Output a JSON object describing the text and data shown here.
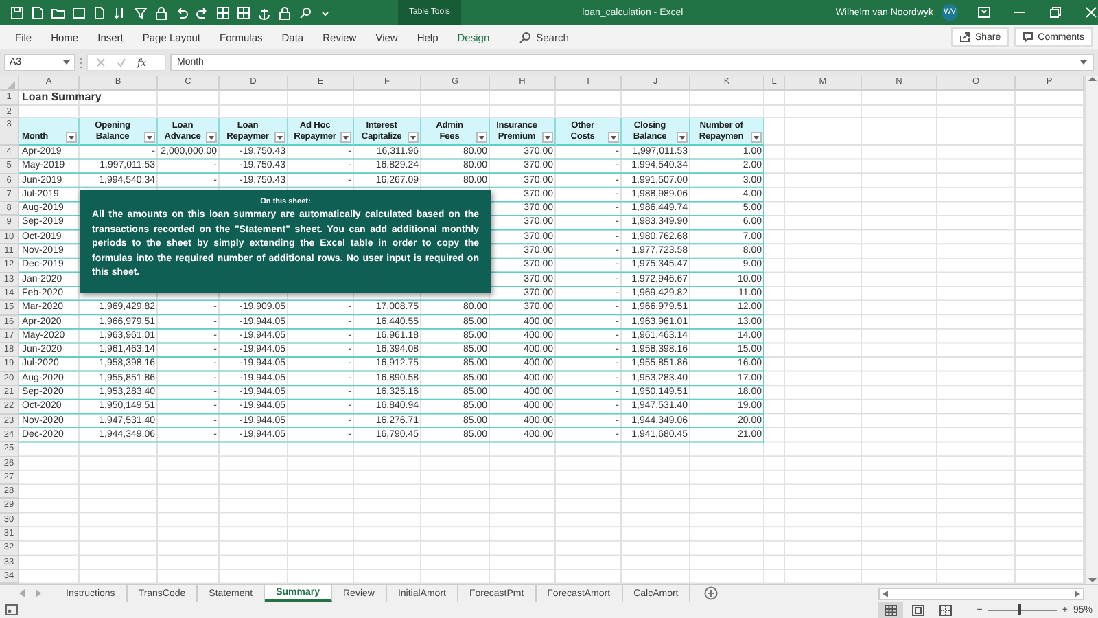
{
  "title_bar": {
    "context_label": "Table Tools",
    "title": "loan_calculation  -  Excel",
    "user": "Wilhelm van Noordwyk",
    "initials": "WV"
  },
  "menu": [
    {
      "label": "File",
      "contextual": false
    },
    {
      "label": "Home",
      "contextual": false
    },
    {
      "label": "Insert",
      "contextual": false
    },
    {
      "label": "Page Layout",
      "contextual": false
    },
    {
      "label": "Formulas",
      "contextual": false
    },
    {
      "label": "Data",
      "contextual": false
    },
    {
      "label": "Review",
      "contextual": false
    },
    {
      "label": "View",
      "contextual": false
    },
    {
      "label": "Help",
      "contextual": false
    },
    {
      "label": "Design",
      "contextual": true
    }
  ],
  "search": {
    "placeholder": "Search"
  },
  "share": "Share",
  "comments": "Comments",
  "formula_bar": {
    "name_box": "A3",
    "fx": "fx",
    "formula": "Month"
  },
  "columns": [
    "A",
    "B",
    "C",
    "D",
    "E",
    "F",
    "G",
    "H",
    "I",
    "J",
    "K",
    "L",
    "M",
    "N",
    "O",
    "P"
  ],
  "row_numbers": [
    "1",
    "2",
    "3",
    "4",
    "5",
    "6",
    "7",
    "8",
    "9",
    "10",
    "11",
    "12",
    "13",
    "14",
    "15",
    "16",
    "17",
    "18",
    "19",
    "20",
    "21",
    "22",
    "23",
    "24",
    "25",
    "26",
    "27",
    "28",
    "29",
    "30",
    "31",
    "32",
    "33",
    "34"
  ],
  "sheet": {
    "title": "Loan Summary",
    "headers": [
      "Month",
      "Opening\nBalance",
      "Loan\nAdvance",
      "Loan\nRepaymer",
      "Ad Hoc\nRepaymer",
      "Interest\nCapitalize",
      "Admin\nFees",
      "Insurance\nPremium",
      "Other\nCosts",
      "Closing\nBalance",
      "Number of\nRepaymen"
    ],
    "rows": [
      {
        "cells": [
          "Apr-2019",
          "-",
          "2,000,000.00",
          "-19,750.43",
          "-",
          "16,311.96",
          "80.00",
          "370.00",
          "-",
          "1,997,011.53",
          "1.00"
        ]
      },
      {
        "cells": [
          "May-2019",
          "1,997,011.53",
          "-",
          "-19,750.43",
          "-",
          "16,829.24",
          "80.00",
          "370.00",
          "-",
          "1,994,540.34",
          "2.00"
        ]
      },
      {
        "cells": [
          "Jun-2019",
          "1,994,540.34",
          "-",
          "-19,750.43",
          "-",
          "16,267.09",
          "80.00",
          "370.00",
          "-",
          "1,991,507.00",
          "3.00"
        ]
      },
      {
        "cells": [
          "Jul-2019",
          null,
          null,
          null,
          null,
          null,
          null,
          "370.00",
          "-",
          "1,988,989.06",
          "4.00"
        ]
      },
      {
        "cells": [
          "Aug-2019",
          null,
          null,
          null,
          null,
          null,
          null,
          "370.00",
          "-",
          "1,986,449.74",
          "5.00"
        ]
      },
      {
        "cells": [
          "Sep-2019",
          null,
          null,
          null,
          null,
          null,
          null,
          "370.00",
          "-",
          "1,983,349.90",
          "6.00"
        ]
      },
      {
        "cells": [
          "Oct-2019",
          null,
          null,
          null,
          null,
          null,
          null,
          "370.00",
          "-",
          "1,980,762.68",
          "7.00"
        ]
      },
      {
        "cells": [
          "Nov-2019",
          null,
          null,
          null,
          null,
          null,
          null,
          "370.00",
          "-",
          "1,977,723.58",
          "8.00"
        ]
      },
      {
        "cells": [
          "Dec-2019",
          null,
          null,
          null,
          null,
          null,
          null,
          "370.00",
          "-",
          "1,975,345.47",
          "9.00"
        ]
      },
      {
        "cells": [
          "Jan-2020",
          null,
          null,
          null,
          null,
          null,
          null,
          "370.00",
          "-",
          "1,972,946.67",
          "10.00"
        ]
      },
      {
        "cells": [
          "Feb-2020",
          null,
          null,
          null,
          null,
          null,
          null,
          "370.00",
          "-",
          "1,969,429.82",
          "11.00"
        ]
      },
      {
        "cells": [
          "Mar-2020",
          "1,969,429.82",
          "-",
          "-19,909.05",
          "-",
          "17,008.75",
          "80.00",
          "370.00",
          "-",
          "1,966,979.51",
          "12.00"
        ]
      },
      {
        "cells": [
          "Apr-2020",
          "1,966,979.51",
          "-",
          "-19,944.05",
          "-",
          "16,440.55",
          "85.00",
          "400.00",
          "-",
          "1,963,961.01",
          "13.00"
        ]
      },
      {
        "cells": [
          "May-2020",
          "1,963,961.01",
          "-",
          "-19,944.05",
          "-",
          "16,961.18",
          "85.00",
          "400.00",
          "-",
          "1,961,463.14",
          "14.00"
        ]
      },
      {
        "cells": [
          "Jun-2020",
          "1,961,463.14",
          "-",
          "-19,944.05",
          "-",
          "16,394.08",
          "85.00",
          "400.00",
          "-",
          "1,958,398.16",
          "15.00"
        ]
      },
      {
        "cells": [
          "Jul-2020",
          "1,958,398.16",
          "-",
          "-19,944.05",
          "-",
          "16,912.75",
          "85.00",
          "400.00",
          "-",
          "1,955,851.86",
          "16.00"
        ]
      },
      {
        "cells": [
          "Aug-2020",
          "1,955,851.86",
          "-",
          "-19,944.05",
          "-",
          "16,890.58",
          "85.00",
          "400.00",
          "-",
          "1,953,283.40",
          "17.00"
        ]
      },
      {
        "cells": [
          "Sep-2020",
          "1,953,283.40",
          "-",
          "-19,944.05",
          "-",
          "16,325.16",
          "85.00",
          "400.00",
          "-",
          "1,950,149.51",
          "18.00"
        ]
      },
      {
        "cells": [
          "Oct-2020",
          "1,950,149.51",
          "-",
          "-19,944.05",
          "-",
          "16,840.94",
          "85.00",
          "400.00",
          "-",
          "1,947,531.40",
          "19.00"
        ]
      },
      {
        "cells": [
          "Nov-2020",
          "1,947,531.40",
          "-",
          "-19,944.05",
          "-",
          "16,276.71",
          "85.00",
          "400.00",
          "-",
          "1,944,349.06",
          "20.00"
        ]
      },
      {
        "cells": [
          "Dec-2020",
          "1,944,349.06",
          "-",
          "-19,944.05",
          "-",
          "16,790.45",
          "85.00",
          "400.00",
          "-",
          "1,941,680.45",
          "21.00"
        ]
      }
    ]
  },
  "note": {
    "heading": "On this sheet:",
    "body": "All the amounts on this loan summary are automatically calculated based on the transactions recorded on the \"Statement\" sheet. You can add additional monthly periods to the sheet by simply extending the Excel table in order to copy the formulas into the required number of additional rows. No user input is required on this sheet."
  },
  "sheet_tabs": [
    {
      "label": "Instructions",
      "selected": false
    },
    {
      "label": "TransCode",
      "selected": false
    },
    {
      "label": "Statement",
      "selected": false
    },
    {
      "label": "Summary",
      "selected": true
    },
    {
      "label": "Review",
      "selected": false
    },
    {
      "label": "InitialAmort",
      "selected": false
    },
    {
      "label": "ForecastPmt",
      "selected": false
    },
    {
      "label": "ForecastAmort",
      "selected": false
    },
    {
      "label": "CalcAmort",
      "selected": false
    }
  ],
  "status_bar": {
    "views": [
      {
        "kind": "normal",
        "selected": true
      },
      {
        "kind": "page_layout",
        "selected": false
      },
      {
        "kind": "page_break",
        "selected": false
      }
    ],
    "zoom": {
      "minus": "−",
      "plus": "+",
      "level": 0.46,
      "reading": "95%"
    }
  }
}
